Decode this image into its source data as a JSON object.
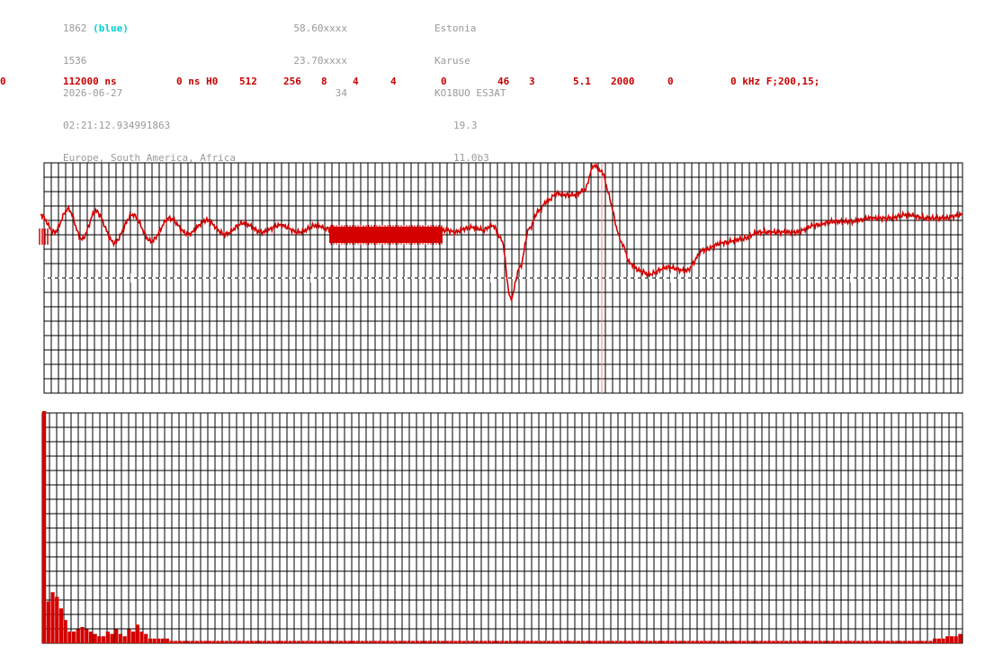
{
  "header": {
    "col1": {
      "id_number": "1862",
      "id_color": "(blue)",
      "code": "1536",
      "date": "2026-06-27",
      "time": "02:21:12.934991863",
      "regions": "Europe, South America, Africa"
    },
    "col2": {
      "lat": "58.60xxxx",
      "lon": "23.70xxxx",
      "count": "34"
    },
    "col3": {
      "country": "Estonia",
      "place": "Karuse",
      "locator": "KO18UO ES3AT",
      "value1": "19.3",
      "value2": "11.0b3"
    }
  },
  "params": [
    "0",
    "112000 ns",
    "0 ns H0",
    "512",
    "256",
    "8",
    "4",
    "4",
    "0",
    "46",
    "3",
    "5.1",
    "2000",
    "0",
    "0 kHz F;200,15;"
  ],
  "colors": {
    "trace": "#d40000",
    "grid": "#000000",
    "dashed_line": "#ffffff",
    "header_text": "#9a9a9a",
    "blue_label": "#00d2d2",
    "param_text": "#c80000"
  },
  "chart_data": [
    {
      "type": "line",
      "series": [
        {
          "x": [
            0,
            0.015,
            0.03,
            0.045,
            0.06,
            0.08,
            0.1,
            0.12,
            0.14,
            0.16,
            0.18,
            0.2,
            0.22,
            0.24,
            0.26,
            0.28,
            0.3,
            0.31,
            0.32,
            0.33,
            0.34,
            0.35,
            0.36,
            0.37,
            0.38,
            0.39,
            0.4,
            0.41,
            0.42,
            0.43,
            0.44,
            0.45,
            0.46,
            0.47,
            0.48,
            0.49,
            0.5,
            0.51,
            0.52,
            0.53,
            0.54,
            0.55,
            0.56,
            0.57,
            0.58,
            0.59,
            0.6,
            0.61,
            0.615,
            0.62,
            0.625,
            0.63,
            0.64,
            0.65,
            0.66,
            0.68,
            0.7,
            0.72,
            0.74,
            0.76,
            0.78,
            0.8,
            0.82,
            0.84,
            0.86,
            0.88,
            0.9,
            0.92,
            0.94,
            0.96,
            0.98,
            1.0
          ],
          "y": [
            0.3,
            0.05,
            0.38,
            -0.05,
            0.35,
            -0.1,
            0.3,
            -0.08,
            0.25,
            0.02,
            0.22,
            0.02,
            0.18,
            0.05,
            0.15,
            0.05,
            0.15,
            0.1,
            0.08,
            0.05,
            0.08,
            0.05,
            0.08,
            0.05,
            0.08,
            0.05,
            0.08,
            0.05,
            0.08,
            0.05,
            0.08,
            0.05,
            0.1,
            0.12,
            0.08,
            0.15,
            -0.05,
            -0.9,
            -0.45,
            0.1,
            0.35,
            0.5,
            0.6,
            0.58,
            0.58,
            0.65,
            1.0,
            0.9,
            0.65,
            0.4,
            0.1,
            -0.1,
            -0.4,
            -0.5,
            -0.55,
            -0.45,
            -0.5,
            -0.2,
            -0.1,
            -0.05,
            0.05,
            0.05,
            0.05,
            0.15,
            0.2,
            0.2,
            0.25,
            0.25,
            0.3,
            0.25,
            0.25,
            0.3
          ]
        }
      ]
    },
    {
      "type": "bar",
      "values": [
        1.0,
        0.18,
        0.22,
        0.2,
        0.15,
        0.1,
        0.05,
        0.05,
        0.06,
        0.07,
        0.06,
        0.05,
        0.04,
        0.03,
        0.03,
        0.05,
        0.04,
        0.06,
        0.04,
        0.03,
        0.06,
        0.05,
        0.08,
        0.05,
        0.04,
        0.02,
        0.02,
        0.02,
        0.02,
        0.02,
        0.01,
        0.01,
        0.01,
        0.01,
        0.01,
        0.01,
        0.01,
        0.01,
        0.01,
        0.01,
        0.01,
        0.01,
        0.01,
        0.01,
        0.01,
        0.01,
        0.01,
        0.01,
        0.01,
        0.01,
        0.01,
        0.01,
        0.01,
        0.01,
        0.01,
        0.01,
        0.01,
        0.01,
        0.01,
        0.01,
        0.01,
        0.01,
        0.01,
        0.01,
        0.01,
        0.01,
        0.01,
        0.01,
        0.01,
        0.01,
        0.01,
        0.01,
        0.01,
        0.01,
        0.01,
        0.01,
        0.01,
        0.01,
        0.01,
        0.01,
        0.01,
        0.01,
        0.01,
        0.01,
        0.01,
        0.01,
        0.01,
        0.01,
        0.01,
        0.01,
        0.01,
        0.01,
        0.01,
        0.01,
        0.01,
        0.01,
        0.01,
        0.01,
        0.01,
        0.01,
        0.01,
        0.01,
        0.01,
        0.01,
        0.01,
        0.01,
        0.01,
        0.01,
        0.01,
        0.01,
        0.01,
        0.01,
        0.01,
        0.01,
        0.01,
        0.01,
        0.01,
        0.01,
        0.01,
        0.01,
        0.01,
        0.01,
        0.01,
        0.01,
        0.01,
        0.01,
        0.01,
        0.01,
        0.01,
        0.01,
        0.01,
        0.01,
        0.01,
        0.01,
        0.01,
        0.01,
        0.01,
        0.01,
        0.01,
        0.01,
        0.01,
        0.01,
        0.01,
        0.01,
        0.01,
        0.01,
        0.01,
        0.01,
        0.01,
        0.01,
        0.01,
        0.01,
        0.01,
        0.01,
        0.01,
        0.01,
        0.01,
        0.01,
        0.01,
        0.01,
        0.01,
        0.01,
        0.01,
        0.01,
        0.01,
        0.01,
        0.01,
        0.01,
        0.01,
        0.01,
        0.01,
        0.01,
        0.01,
        0.01,
        0.01,
        0.01,
        0.01,
        0.01,
        0.01,
        0.01,
        0.01,
        0.01,
        0.01,
        0.01,
        0.01,
        0.01,
        0.01,
        0.01,
        0.01,
        0.01,
        0.01,
        0.01,
        0.01,
        0.01,
        0.01,
        0.01,
        0.01,
        0.01,
        0.01,
        0.01,
        0.01,
        0.01,
        0.01,
        0.01,
        0.01,
        0.01,
        0.01,
        0.01,
        0.01,
        0.01,
        0.02,
        0.02,
        0.02,
        0.03,
        0.03,
        0.03,
        0.04
      ]
    }
  ]
}
